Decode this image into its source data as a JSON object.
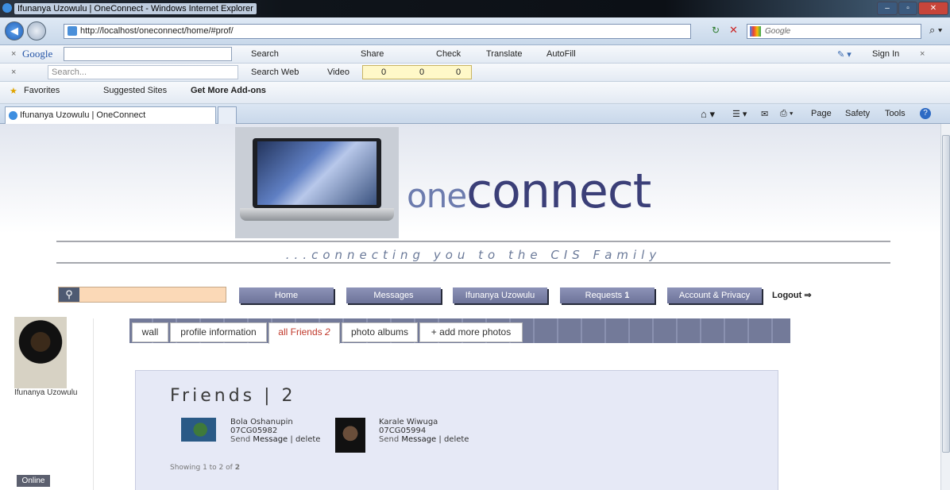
{
  "window": {
    "title": "Ifunanya Uzowulu | OneConnect - Windows Internet Explorer"
  },
  "address": {
    "url": "http://localhost/oneconnect/home/#prof/",
    "search_placeholder": "Google"
  },
  "google_toolbar": {
    "label": "Google",
    "items": [
      "Search",
      "Share",
      "Check",
      "Translate",
      "AutoFill"
    ],
    "sign_in": "Sign In"
  },
  "search_toolbar": {
    "placeholder": "Search...",
    "search_web": "Search Web",
    "video": "Video",
    "counts": [
      "0",
      "0",
      "0"
    ]
  },
  "favorites_bar": {
    "favorites": "Favorites",
    "suggested": "Suggested Sites",
    "addons": "Get More Add-ons"
  },
  "tab": {
    "title": "Ifunanya Uzowulu | OneConnect"
  },
  "command_bar": {
    "page": "Page",
    "safety": "Safety",
    "tools": "Tools"
  },
  "site": {
    "brand_one": "one",
    "brand_connect": "connect",
    "tagline": "...connecting you to the CIS Family",
    "nav": [
      "Home",
      "Messages",
      "Ifunanya Uzowulu",
      "Requests"
    ],
    "requests_count": "1",
    "account": "Account & Privacy",
    "logout": "Logout ⇒",
    "user_name": "Ifunanya Uzowulu",
    "online": "Online"
  },
  "profile_tabs": {
    "wall": "wall",
    "info": "profile information",
    "friends": "all Friends",
    "friends_count": "2",
    "albums": "photo albums",
    "add_photos": "+ add more photos"
  },
  "friends": {
    "heading": "Friends | 2",
    "list": [
      {
        "name": "Bola Oshanupin",
        "id": "07CG05982",
        "send": "Send",
        "message": "Message",
        "sep": "|",
        "delete": "delete"
      },
      {
        "name": "Karale Wiwuga",
        "id": "07CG05994",
        "send": "Send",
        "message": "Message",
        "sep": "|",
        "delete": "delete"
      }
    ],
    "showing": "Showing 1 to 2 of",
    "showing_total": "2"
  },
  "colors": {
    "nav_button": "#7a80a6",
    "search_field": "#fbd9b7",
    "friends_bg": "#e6e9f6",
    "brand": "#3b3f78"
  }
}
